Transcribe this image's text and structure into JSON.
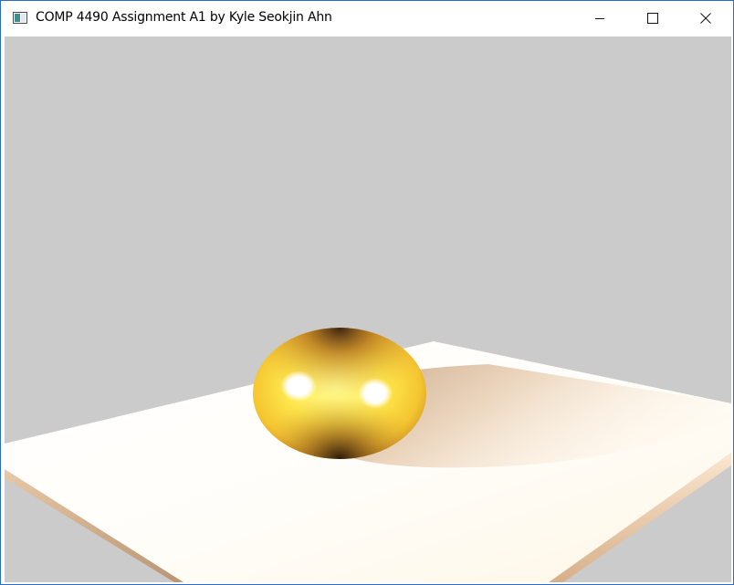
{
  "window": {
    "title": "COMP 4490 Assignment A1 by Kyle Seokjin Ahn",
    "icon": "app-window-icon",
    "controls": {
      "minimize": "minimize-icon",
      "maximize": "maximize-icon",
      "close": "close-icon"
    }
  },
  "scene": {
    "background_color": "#cbcbcb",
    "floor_color": "#ffffff",
    "sphere_color": "#ffe45a",
    "shadow_color": "#c4a27d"
  }
}
